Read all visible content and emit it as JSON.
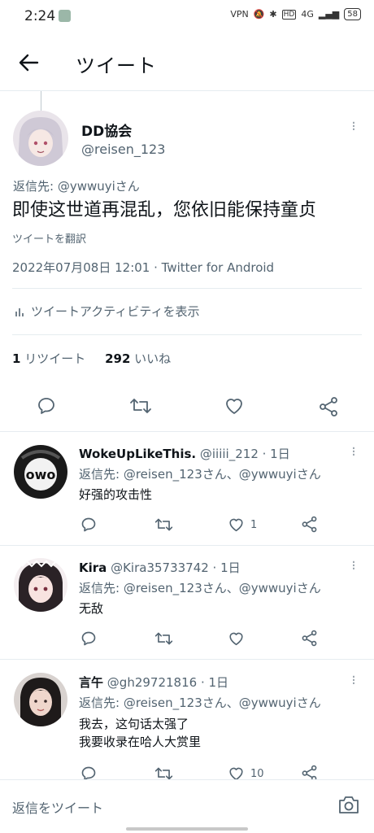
{
  "status_bar": {
    "time": "2:24",
    "icons": [
      "vpn-icon",
      "mute-icon",
      "bluetooth-icon",
      "hd-icon",
      "signal-icon"
    ],
    "network": "4G",
    "battery": "58"
  },
  "header": {
    "title": "ツイート"
  },
  "main_tweet": {
    "display_name": "DD協会",
    "handle": "@reisen_123",
    "reply_to": "返信先: @ywwuyiさん",
    "text": "即使这世道再混乱，您依旧能保持童贞",
    "translate": "ツイートを翻訳",
    "datetime": "2022年07月08日 12:01 · Twitter for Android",
    "activity": "ツイートアクティビティを表示",
    "retweet_count": "1",
    "retweet_label": "リツイート",
    "like_count": "292",
    "like_label": "いいね"
  },
  "replies": [
    {
      "display_name": "WokeUpLikeThis.",
      "meta": "@iiiii_212 · 1日",
      "reply_to": "返信先: @reisen_123さん、@ywwuyiさん",
      "lines": [
        "好强的攻击性"
      ],
      "like_count": "1"
    },
    {
      "display_name": "Kira",
      "meta": "@Kira35733742 · 1日",
      "reply_to": "返信先: @reisen_123さん、@ywwuyiさん",
      "lines": [
        "无敌"
      ],
      "like_count": ""
    },
    {
      "display_name": "言午",
      "meta": "@gh29721816 · 1日",
      "reply_to": "返信先: @reisen_123さん、@ywwuyiさん",
      "lines": [
        "我去，这句话太强了",
        "我要收录在哈人大赏里"
      ],
      "like_count": "10"
    }
  ],
  "composer": {
    "placeholder": "返信をツイート"
  },
  "colors": {
    "text_primary": "#0f1419",
    "text_secondary": "#536471",
    "divider": "#e6ecf0"
  }
}
